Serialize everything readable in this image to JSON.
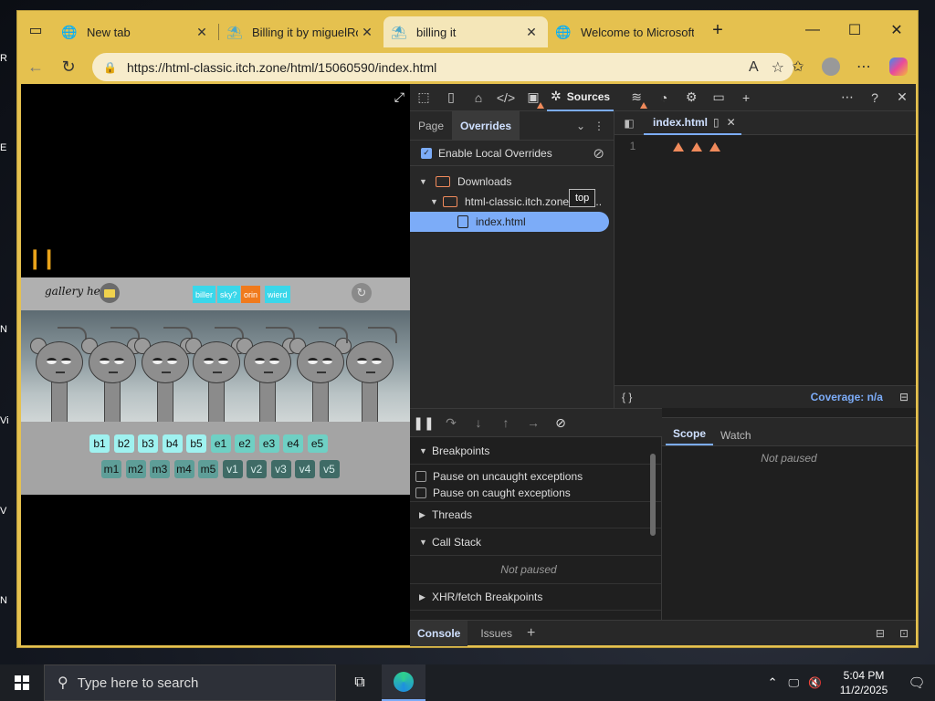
{
  "browser": {
    "tabs": [
      {
        "title": "New tab",
        "icon": "globe-icon",
        "active": false
      },
      {
        "title": "Billing it by miguelRob",
        "icon": "itch-icon",
        "active": false
      },
      {
        "title": "billing it",
        "icon": "itch-icon",
        "active": true
      },
      {
        "title": "Welcome to Microsoft",
        "icon": "globe-icon",
        "active": false
      }
    ],
    "close_glyph": "✕",
    "url": "https://html-classic.itch.zone/html/15060590/index.html"
  },
  "game": {
    "gallery_label": "gallery here",
    "modes": [
      {
        "label": "biller",
        "color": "#3ad7ea"
      },
      {
        "label": "sky?",
        "color": "#3ad7ea"
      },
      {
        "label": "orin",
        "color": "#f07a1c"
      },
      {
        "label": "wierd",
        "color": "#3ad7ea"
      }
    ],
    "row1": [
      "b1",
      "b2",
      "b3",
      "b4",
      "b5",
      "e1",
      "e2",
      "e3",
      "e4",
      "e5"
    ],
    "row2": [
      "m1",
      "m2",
      "m3",
      "m4",
      "m5",
      "v1",
      "v2",
      "v3",
      "v4",
      "v5"
    ],
    "colors": {
      "b": "#9ff2f0",
      "e": "#6fd0c4",
      "m": "#5e9e98",
      "v": "#3f6b66"
    },
    "character_count": 7
  },
  "devtools": {
    "sources_label": "Sources",
    "nav_tabs": [
      "Page",
      "Overrides"
    ],
    "enable_overrides_label": "Enable Local Overrides",
    "tree": {
      "downloads": "Downloads",
      "domain": "html-classic.itch.zone/html...",
      "file": "index.html"
    },
    "tooltip": "top",
    "editor_tab": "index.html",
    "line_number": "1",
    "braces": "{ }",
    "coverage": "Coverage: n/a",
    "sections": {
      "breakpoints": "Breakpoints",
      "pause_uncaught": "Pause on uncaught exceptions",
      "pause_caught": "Pause on caught exceptions",
      "threads": "Threads",
      "call_stack": "Call Stack",
      "not_paused": "Not paused",
      "xhr": "XHR/fetch Breakpoints"
    },
    "scope_tabs": [
      "Scope",
      "Watch"
    ],
    "scope_not_paused": "Not paused",
    "drawer_tabs": [
      "Console",
      "Issues"
    ]
  },
  "taskbar": {
    "search_placeholder": "Type here to search",
    "time": "5:04 PM",
    "date": "11/2/2025"
  },
  "desktop_labels": [
    "R",
    "E",
    "N",
    "Vi",
    "V",
    "N"
  ]
}
